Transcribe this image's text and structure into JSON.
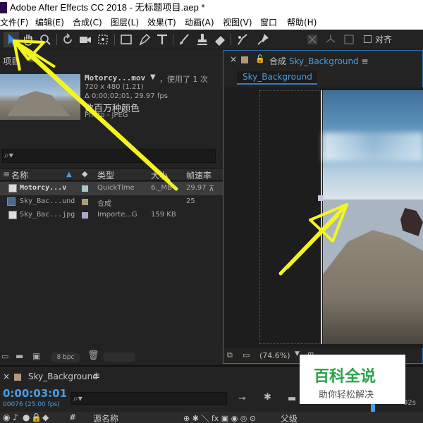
{
  "window": {
    "title": "Adobe After Effects CC 2018 - 无标题项目.aep *"
  },
  "menu": {
    "items": [
      "文件(F)",
      "编辑(E)",
      "合成(C)",
      "图层(L)",
      "效果(T)",
      "动画(A)",
      "视图(V)",
      "窗口",
      "帮助(H)"
    ]
  },
  "toolbar": {
    "tools": [
      "selection-icon",
      "hand-icon",
      "zoom-icon",
      "rotate-icon",
      "camera-icon",
      "pan-behind-icon",
      "rectangle-icon",
      "pen-icon",
      "type-icon",
      "brush-icon",
      "clone-stamp-icon",
      "eraser-icon",
      "roto-brush-icon",
      "puppet-pin-icon"
    ],
    "align_label": "对齐"
  },
  "project": {
    "title": "项目",
    "menu_glyph": "≡",
    "selected_info": {
      "name": "Motorcy...mov",
      "used": "，使用了 1 次",
      "dimensions": "720 x 480 (1.21)",
      "duration": "Δ 0;00;02;01, 29.97 fps",
      "colors": "数百万种颜色",
      "codec": "Photo - JPEG"
    },
    "columns": {
      "name": "名称",
      "type": "类型",
      "size": "大小",
      "fps": "帧速率"
    },
    "rows": [
      {
        "name": "Motorcy...v",
        "type": "QuickTime",
        "size": "6._MB",
        "fps": "29.97",
        "label_color": "#a8c8c8"
      },
      {
        "name": "Sky_Bac...und",
        "type": "合成",
        "size": "",
        "fps": "25",
        "label_color": "#b09a7a"
      },
      {
        "name": "Sky_Bac...jpg",
        "type": "Importe...G",
        "size": "159 KB",
        "fps": "",
        "label_color": "#a8a8c8"
      }
    ],
    "bpc": "8 bpc"
  },
  "comp": {
    "title_prefix": "合成",
    "title_name": "Sky_Background",
    "tab": "Sky_Background",
    "zoom": "(74.6%)"
  },
  "timeline": {
    "tab": "Sky_Background",
    "menu_glyph": "≡",
    "timecode": "0:00:03:01",
    "frames": "00076 (25.00 fps)",
    "col_hash": "#",
    "col_source": "源名称",
    "col_parent": "父级",
    "ruler_label": "02s"
  },
  "watermark": {
    "title": "百科全说",
    "subtitle": "助你轻松解决"
  },
  "colors": {
    "accent": "#4a9de0",
    "annotation": "#f5f51e"
  }
}
